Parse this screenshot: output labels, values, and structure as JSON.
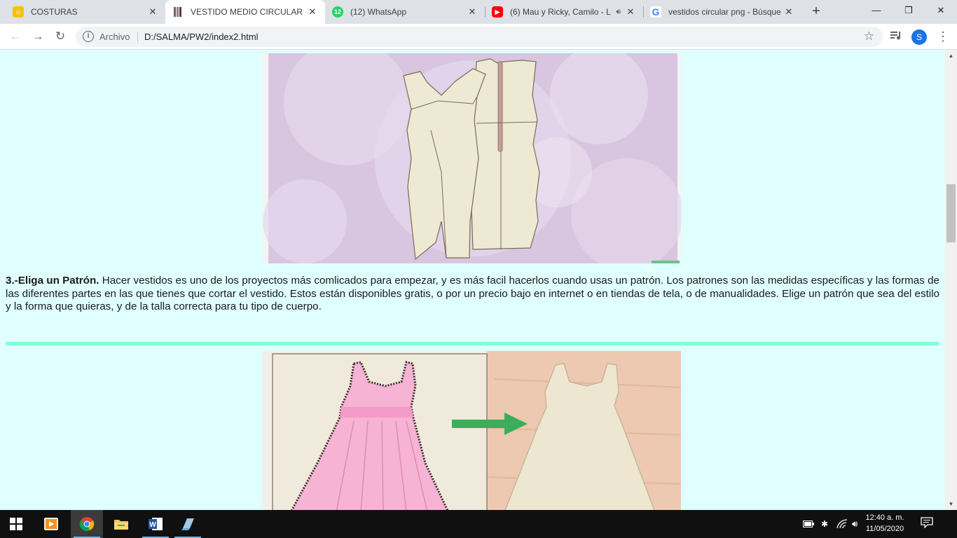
{
  "browser": {
    "tabs": [
      {
        "title": "COSTURAS",
        "icon": "costuras-favicon",
        "active": false
      },
      {
        "title": "VESTIDO MEDIO CIRCULAR",
        "icon": "dress-favicon",
        "active": true
      },
      {
        "title": "(12) WhatsApp",
        "icon": "whatsapp-icon",
        "badge": "12",
        "active": false
      },
      {
        "title": "(6) Mau y Ricky, Camilo - L",
        "icon": "youtube-icon",
        "audio": true,
        "active": false
      },
      {
        "title": "vestidos circular png - Búsque",
        "icon": "google-icon",
        "active": false
      }
    ],
    "new_tab_label": "+",
    "address": {
      "protocol_label": "Archivo",
      "url": "D:/SALMA/PW2/index2.html"
    },
    "profile_initial": "S"
  },
  "page": {
    "step": {
      "heading": "3.-Eliga un Patrón.",
      "body": " Hacer vestidos es uno de los proyectos más comlicados para empezar, y es más facil hacerlos cuando usas un patrón. Los patrones son las medidas específicas y las formas de las diferentes partes en las que tienes que cortar el vestido. Estos están disponibles gratis, o por un precio bajo en internet o en tiendas de tela, o de manualidades. Elige un patrón que sea del estilo y la forma que quieras, y de la talla correcta para tu tipo de cuerpo."
    },
    "colors": {
      "page_bg": "#e0ffff",
      "divider": "#7fffd4"
    }
  },
  "taskbar": {
    "apps": [
      "windows-start",
      "media-player",
      "chrome",
      "file-explorer",
      "word",
      "notepad-app"
    ],
    "clock": {
      "time": "12:40 a. m.",
      "date": "11/05/2020"
    }
  }
}
